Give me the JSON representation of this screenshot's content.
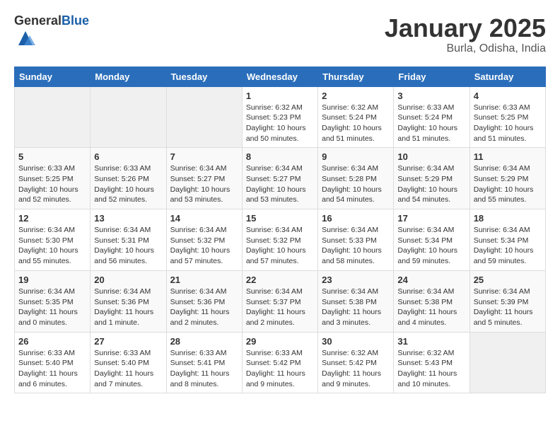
{
  "logo": {
    "general": "General",
    "blue": "Blue"
  },
  "title": "January 2025",
  "subtitle": "Burla, Odisha, India",
  "weekdays": [
    "Sunday",
    "Monday",
    "Tuesday",
    "Wednesday",
    "Thursday",
    "Friday",
    "Saturday"
  ],
  "weeks": [
    [
      {
        "day": "",
        "info": ""
      },
      {
        "day": "",
        "info": ""
      },
      {
        "day": "",
        "info": ""
      },
      {
        "day": "1",
        "info": "Sunrise: 6:32 AM\nSunset: 5:23 PM\nDaylight: 10 hours\nand 50 minutes."
      },
      {
        "day": "2",
        "info": "Sunrise: 6:32 AM\nSunset: 5:24 PM\nDaylight: 10 hours\nand 51 minutes."
      },
      {
        "day": "3",
        "info": "Sunrise: 6:33 AM\nSunset: 5:24 PM\nDaylight: 10 hours\nand 51 minutes."
      },
      {
        "day": "4",
        "info": "Sunrise: 6:33 AM\nSunset: 5:25 PM\nDaylight: 10 hours\nand 51 minutes."
      }
    ],
    [
      {
        "day": "5",
        "info": "Sunrise: 6:33 AM\nSunset: 5:25 PM\nDaylight: 10 hours\nand 52 minutes."
      },
      {
        "day": "6",
        "info": "Sunrise: 6:33 AM\nSunset: 5:26 PM\nDaylight: 10 hours\nand 52 minutes."
      },
      {
        "day": "7",
        "info": "Sunrise: 6:34 AM\nSunset: 5:27 PM\nDaylight: 10 hours\nand 53 minutes."
      },
      {
        "day": "8",
        "info": "Sunrise: 6:34 AM\nSunset: 5:27 PM\nDaylight: 10 hours\nand 53 minutes."
      },
      {
        "day": "9",
        "info": "Sunrise: 6:34 AM\nSunset: 5:28 PM\nDaylight: 10 hours\nand 54 minutes."
      },
      {
        "day": "10",
        "info": "Sunrise: 6:34 AM\nSunset: 5:29 PM\nDaylight: 10 hours\nand 54 minutes."
      },
      {
        "day": "11",
        "info": "Sunrise: 6:34 AM\nSunset: 5:29 PM\nDaylight: 10 hours\nand 55 minutes."
      }
    ],
    [
      {
        "day": "12",
        "info": "Sunrise: 6:34 AM\nSunset: 5:30 PM\nDaylight: 10 hours\nand 55 minutes."
      },
      {
        "day": "13",
        "info": "Sunrise: 6:34 AM\nSunset: 5:31 PM\nDaylight: 10 hours\nand 56 minutes."
      },
      {
        "day": "14",
        "info": "Sunrise: 6:34 AM\nSunset: 5:32 PM\nDaylight: 10 hours\nand 57 minutes."
      },
      {
        "day": "15",
        "info": "Sunrise: 6:34 AM\nSunset: 5:32 PM\nDaylight: 10 hours\nand 57 minutes."
      },
      {
        "day": "16",
        "info": "Sunrise: 6:34 AM\nSunset: 5:33 PM\nDaylight: 10 hours\nand 58 minutes."
      },
      {
        "day": "17",
        "info": "Sunrise: 6:34 AM\nSunset: 5:34 PM\nDaylight: 10 hours\nand 59 minutes."
      },
      {
        "day": "18",
        "info": "Sunrise: 6:34 AM\nSunset: 5:34 PM\nDaylight: 10 hours\nand 59 minutes."
      }
    ],
    [
      {
        "day": "19",
        "info": "Sunrise: 6:34 AM\nSunset: 5:35 PM\nDaylight: 11 hours\nand 0 minutes."
      },
      {
        "day": "20",
        "info": "Sunrise: 6:34 AM\nSunset: 5:36 PM\nDaylight: 11 hours\nand 1 minute."
      },
      {
        "day": "21",
        "info": "Sunrise: 6:34 AM\nSunset: 5:36 PM\nDaylight: 11 hours\nand 2 minutes."
      },
      {
        "day": "22",
        "info": "Sunrise: 6:34 AM\nSunset: 5:37 PM\nDaylight: 11 hours\nand 2 minutes."
      },
      {
        "day": "23",
        "info": "Sunrise: 6:34 AM\nSunset: 5:38 PM\nDaylight: 11 hours\nand 3 minutes."
      },
      {
        "day": "24",
        "info": "Sunrise: 6:34 AM\nSunset: 5:38 PM\nDaylight: 11 hours\nand 4 minutes."
      },
      {
        "day": "25",
        "info": "Sunrise: 6:34 AM\nSunset: 5:39 PM\nDaylight: 11 hours\nand 5 minutes."
      }
    ],
    [
      {
        "day": "26",
        "info": "Sunrise: 6:33 AM\nSunset: 5:40 PM\nDaylight: 11 hours\nand 6 minutes."
      },
      {
        "day": "27",
        "info": "Sunrise: 6:33 AM\nSunset: 5:40 PM\nDaylight: 11 hours\nand 7 minutes."
      },
      {
        "day": "28",
        "info": "Sunrise: 6:33 AM\nSunset: 5:41 PM\nDaylight: 11 hours\nand 8 minutes."
      },
      {
        "day": "29",
        "info": "Sunrise: 6:33 AM\nSunset: 5:42 PM\nDaylight: 11 hours\nand 9 minutes."
      },
      {
        "day": "30",
        "info": "Sunrise: 6:32 AM\nSunset: 5:42 PM\nDaylight: 11 hours\nand 9 minutes."
      },
      {
        "day": "31",
        "info": "Sunrise: 6:32 AM\nSunset: 5:43 PM\nDaylight: 11 hours\nand 10 minutes."
      },
      {
        "day": "",
        "info": ""
      }
    ]
  ]
}
